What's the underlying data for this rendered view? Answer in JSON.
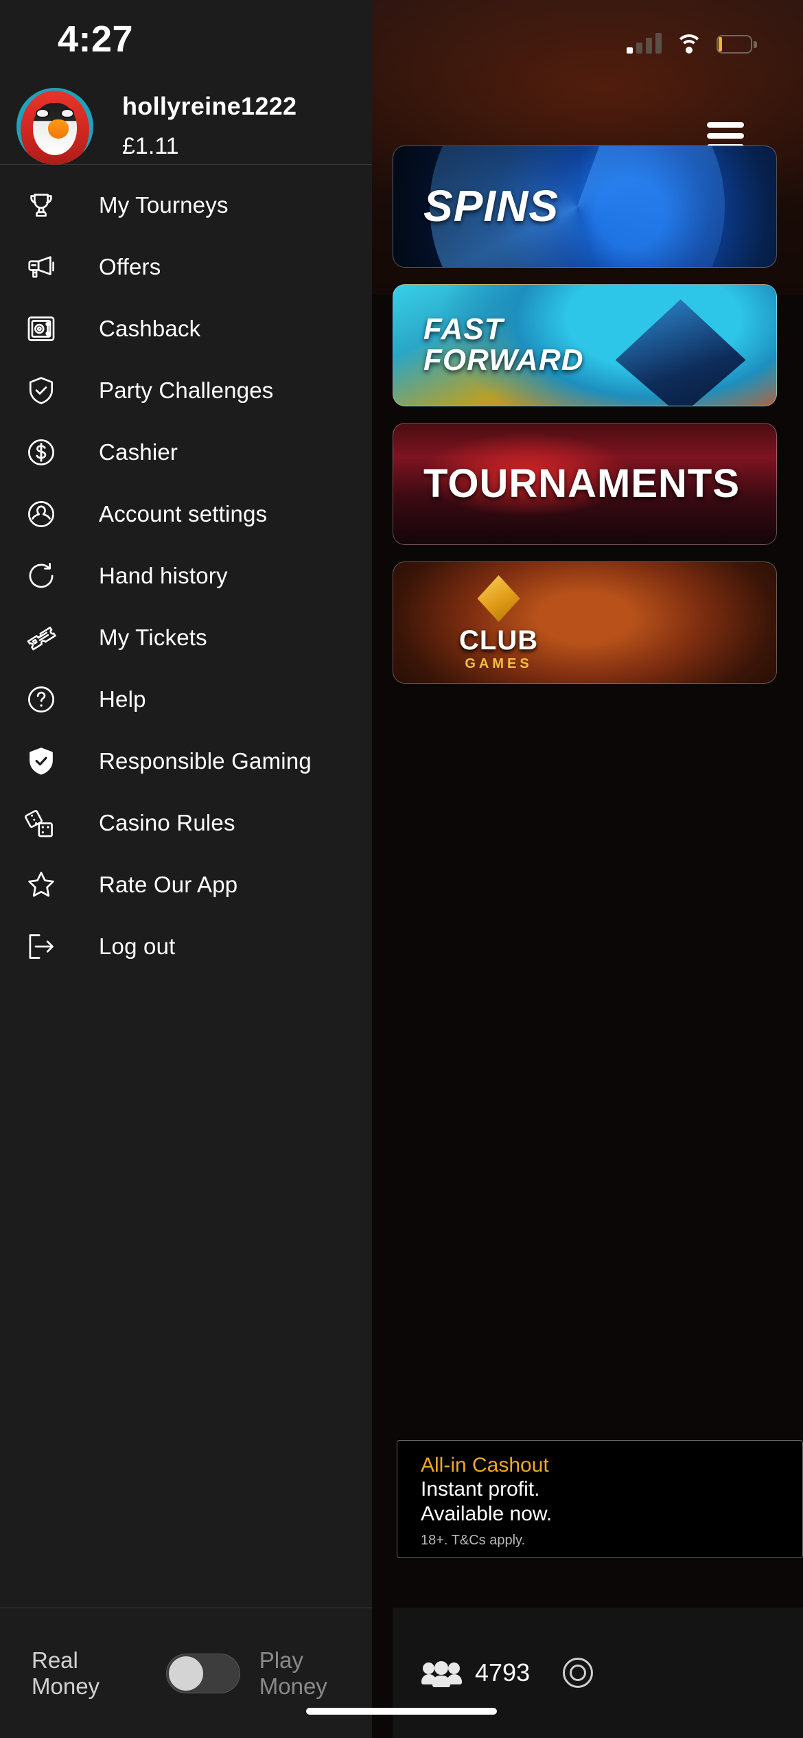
{
  "status_bar": {
    "time": "4:27",
    "signal_icon": "cellular-signal-icon",
    "signal_bars_active": 1,
    "signal_bars_total": 4,
    "wifi_icon": "wifi-icon",
    "battery_icon": "battery-low-icon",
    "battery_color": "#f0b428"
  },
  "drawer": {
    "account": {
      "avatar_icon": "penguin-avatar",
      "username": "hollyreine1222",
      "balance": "£1.11"
    },
    "menu_items": [
      {
        "label": "My Tourneys",
        "icon": "trophy-icon"
      },
      {
        "label": "Offers",
        "icon": "megaphone-icon"
      },
      {
        "label": "Cashback",
        "icon": "safe-vault-icon"
      },
      {
        "label": "Party Challenges",
        "icon": "shield-check-outline-icon"
      },
      {
        "label": "Cashier",
        "icon": "dollar-circle-icon"
      },
      {
        "label": "Account settings",
        "icon": "person-circle-icon"
      },
      {
        "label": "Hand history",
        "icon": "refresh-circle-icon"
      },
      {
        "label": "My Tickets",
        "icon": "ticket-icon"
      },
      {
        "label": "Help",
        "icon": "question-circle-icon"
      },
      {
        "label": "Responsible Gaming",
        "icon": "shield-check-filled-icon"
      },
      {
        "label": "Casino Rules",
        "icon": "dice-icon"
      },
      {
        "label": "Rate Our App",
        "icon": "star-outline-icon"
      },
      {
        "label": "Log out",
        "icon": "logout-arrow-icon"
      }
    ],
    "money_toggle": {
      "left_label": "Real Money",
      "right_label": "Play Money",
      "selected": "Real Money",
      "knob_position": "left"
    }
  },
  "lobby": {
    "menu_button_icon": "hamburger-menu-icon",
    "cards": [
      {
        "title": "SPINS",
        "name": "spins-card"
      },
      {
        "title": "FAST\nFORWARD",
        "title_line1": "FAST",
        "title_line2": "FORWARD",
        "name": "fast-forward-card"
      },
      {
        "title": "TOURNAMENTS",
        "name": "tournaments-card"
      },
      {
        "title": "CLUB",
        "subtitle": "GAMES",
        "name": "club-games-card"
      }
    ],
    "promo": {
      "title": "All-in Cashout",
      "line1": "Instant profit.",
      "line2": "Available now.",
      "terms": "18+. T&Cs apply."
    },
    "bottom_bar": {
      "players_icon": "players-group-icon",
      "players_count": "4793",
      "chips_icon": "coin-icon"
    }
  },
  "colors": {
    "drawer_bg": "#1c1c1c",
    "promo_accent": "#f0a81e",
    "battery_warn": "#f0b428"
  }
}
